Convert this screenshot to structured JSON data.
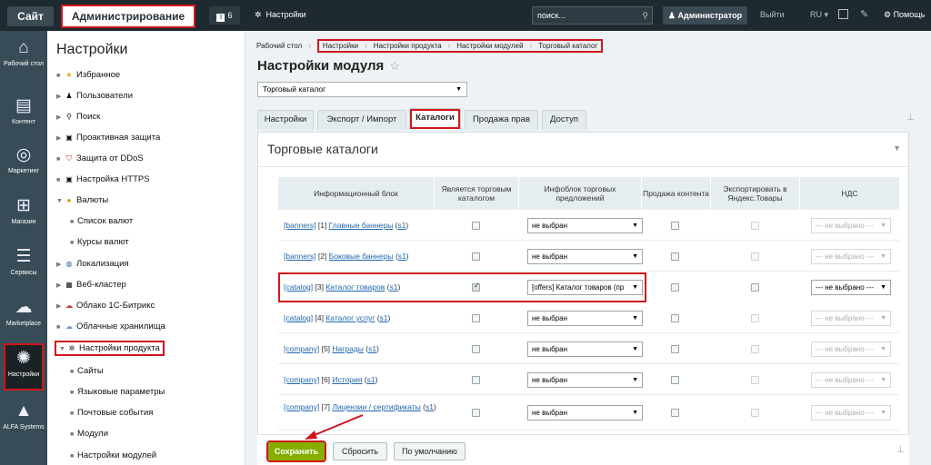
{
  "topbar": {
    "site": "Сайт",
    "admin": "Администрирование",
    "notifications": "6",
    "settings": "Настройки",
    "search_placeholder": "поиск...",
    "user": "Администратор",
    "exit": "Выйти",
    "lang": "RU",
    "help": "Помощь"
  },
  "leftnav": [
    {
      "label": "Рабочий стол",
      "icon": "home-icon"
    },
    {
      "label": "Контент",
      "icon": "document-icon"
    },
    {
      "label": "Маркетинг",
      "icon": "target-icon"
    },
    {
      "label": "Магазин",
      "icon": "cart-icon"
    },
    {
      "label": "Сервисы",
      "icon": "layers-icon"
    },
    {
      "label": "Marketplace",
      "icon": "cloud-download-icon"
    },
    {
      "label": "Настройки",
      "icon": "gear-icon"
    },
    {
      "label": "ALFA Systems",
      "icon": "alfa-logo-icon"
    }
  ],
  "menu": {
    "title": "Настройки",
    "items": [
      {
        "label": "Избранное"
      },
      {
        "label": "Пользователи"
      },
      {
        "label": "Поиск"
      },
      {
        "label": "Проактивная защита"
      },
      {
        "label": "Защита от DDoS"
      },
      {
        "label": "Настройка HTTPS"
      },
      {
        "label": "Валюты"
      },
      {
        "label": "Список валют"
      },
      {
        "label": "Курсы валют"
      },
      {
        "label": "Локализация"
      },
      {
        "label": "Веб-кластер"
      },
      {
        "label": "Облако 1С-Битрикс"
      },
      {
        "label": "Облачные хранилища"
      },
      {
        "label": "Настройки продукта"
      },
      {
        "label": "Сайты"
      },
      {
        "label": "Языковые параметры"
      },
      {
        "label": "Почтовые события"
      },
      {
        "label": "Модули"
      },
      {
        "label": "Настройки модулей"
      }
    ]
  },
  "breadcrumbs": [
    "Рабочий стол",
    "Настройки",
    "Настройки продукта",
    "Настройки модулей",
    "Торговый каталог"
  ],
  "page_title": "Настройки модуля",
  "module_select": "Торговый каталог",
  "tabs": [
    "Настройки",
    "Экспорт / Импорт",
    "Каталоги",
    "Продажа прав",
    "Доступ"
  ],
  "panel_title": "Торговые каталоги",
  "table": {
    "headers": [
      "Информационный блок",
      "Является торговым каталогом",
      "Инфоблок торговых предложений",
      "Продажа контента",
      "Экспортировать в Яндекс.Товары",
      "НДС"
    ],
    "rows": [
      {
        "code": "[banners]",
        "num": "[1]",
        "name": "Главные баннеры",
        "site": "s1",
        "offers": "не выбран",
        "vat": "--- не выбрано ---"
      },
      {
        "code": "[banners]",
        "num": "[2]",
        "name": "Боковые баннеры",
        "site": "s1",
        "offers": "не выбран",
        "vat": "--- не выбрано ---"
      },
      {
        "code": "[catalog]",
        "num": "[3]",
        "name": "Каталог товаров",
        "site": "s1",
        "offers": "[offers] Каталог товаров (пр",
        "vat": "--- не выбрано ---"
      },
      {
        "code": "[catalog]",
        "num": "[4]",
        "name": "Каталог услуг",
        "site": "s1",
        "offers": "не выбран",
        "vat": "--- не выбрано ---"
      },
      {
        "code": "[company]",
        "num": "[5]",
        "name": "Награды",
        "site": "s1",
        "offers": "не выбран",
        "vat": "--- не выбрано ---"
      },
      {
        "code": "[company]",
        "num": "[6]",
        "name": "История",
        "site": "s1",
        "offers": "не выбран",
        "vat": "--- не выбрано ---"
      },
      {
        "code": "[company]",
        "num": "[7]",
        "name": "Лицензии / сертификаты",
        "site": "s1",
        "offers": "не выбран",
        "vat": "--- не выбрано ---"
      }
    ]
  },
  "footer": {
    "save": "Сохранить",
    "reset": "Сбросить",
    "default": "По умолчанию"
  },
  "colors": {
    "highlight": "#d0161c",
    "save": "#86ad00",
    "topbar": "#1e2a30",
    "sidebar": "#374c56"
  }
}
